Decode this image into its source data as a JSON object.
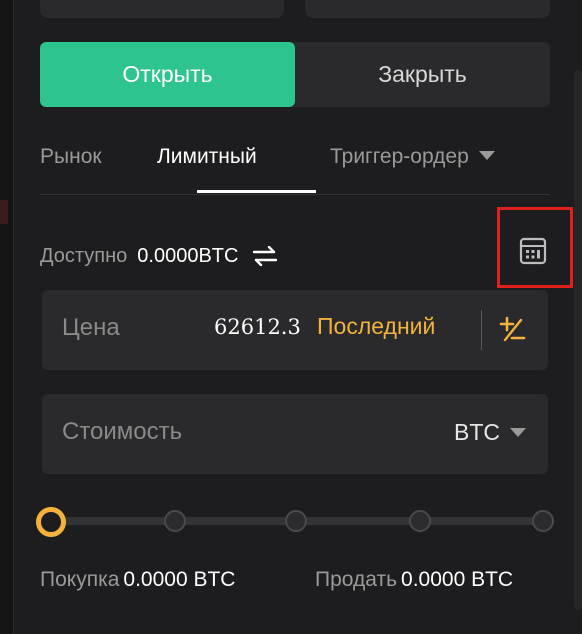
{
  "order_side": {
    "open_label": "Открыть",
    "close_label": "Закрыть",
    "active": "open"
  },
  "order_types": {
    "tabs": [
      {
        "label": "Рынок",
        "active": false
      },
      {
        "label": "Лимитный",
        "active": true
      },
      {
        "label": "Триггер-ордер",
        "active": false,
        "has_dropdown": true
      }
    ]
  },
  "available": {
    "label": "Доступно",
    "value": "0.0000BTC",
    "swap_icon": "swap-arrows-icon",
    "calculator_icon": "calculator-icon"
  },
  "price_field": {
    "label": "Цена",
    "value": "62612.3",
    "last_button": "Последний",
    "plus_minus_icon": "plus-minus-icon"
  },
  "cost_field": {
    "label": "Стоимость",
    "unit": "BTC"
  },
  "slider": {
    "steps": 5,
    "value_fraction": 0
  },
  "summary": {
    "buy_label": "Покупка",
    "buy_value": "0.0000 BTC",
    "sell_label": "Продать",
    "sell_value": "0.0000 BTC"
  },
  "colors": {
    "accent_green": "#2dc48d",
    "accent_yellow": "#f2b23c",
    "highlight_red": "#e0201a",
    "background": "#1d1d1f",
    "field_bg": "#2a2a2c"
  }
}
